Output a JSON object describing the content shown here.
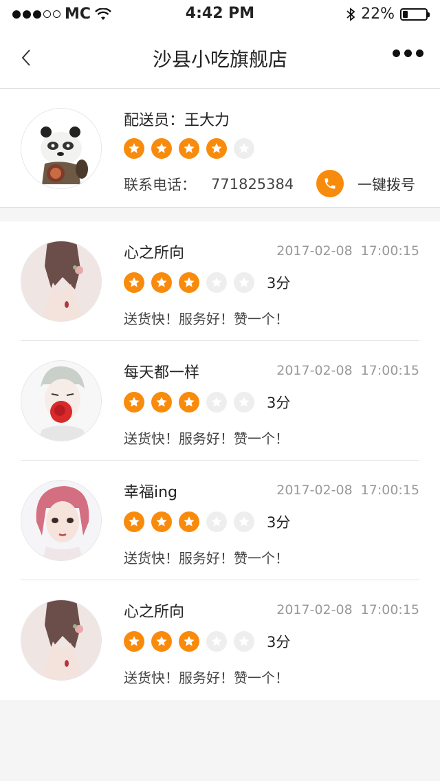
{
  "status_bar": {
    "carrier": "MC",
    "time": "4:42 PM",
    "battery": "22%",
    "battery_level": 0.22
  },
  "nav": {
    "title": "沙县小吃旗舰店"
  },
  "courier": {
    "name": "配送员：王大力",
    "rating": 4,
    "phone_label": "联系电话：",
    "phone": "771825384",
    "call_label": "一键拨号"
  },
  "reviews": [
    {
      "name": "心之所向",
      "date": "2017-02-08",
      "time": "17:00:15",
      "rating": 3,
      "score": "3分",
      "comment": "送货快！服务好！赞一个！",
      "avatar": "girl-back"
    },
    {
      "name": "每天都一样",
      "date": "2017-02-08",
      "time": "17:00:15",
      "rating": 3,
      "score": "3分",
      "comment": "送货快！服务好！赞一个！",
      "avatar": "boy-rose"
    },
    {
      "name": "幸福ing",
      "date": "2017-02-08",
      "time": "17:00:15",
      "rating": 3,
      "score": "3分",
      "comment": "送货快！服务好！赞一个！",
      "avatar": "girl-pink"
    },
    {
      "name": "心之所向",
      "date": "2017-02-08",
      "time": "17:00:15",
      "rating": 3,
      "score": "3分",
      "comment": "送货快！服务好！赞一个！",
      "avatar": "girl-back"
    }
  ],
  "colors": {
    "accent": "#f98b0c",
    "star_off": "#eeeeee"
  }
}
